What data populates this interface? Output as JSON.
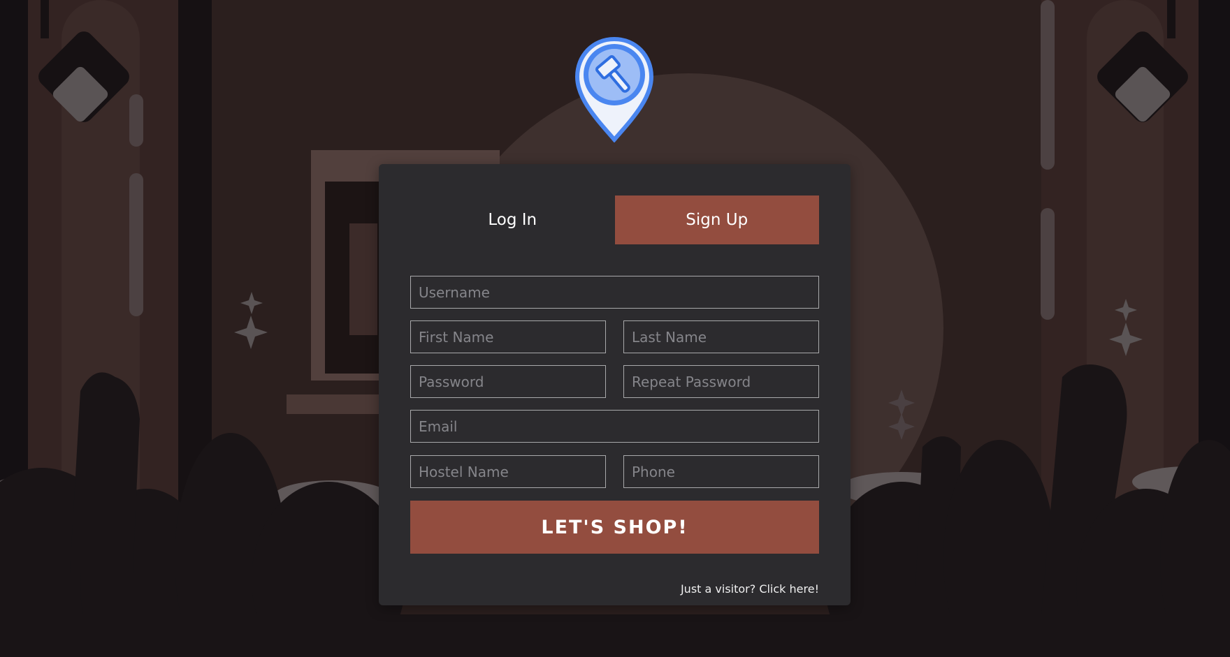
{
  "colors": {
    "accent": "#934d3f",
    "card": "#2c2b2e",
    "background": "#2a1f1e",
    "logo_blue": "#4a86f0"
  },
  "logo": {
    "icon": "auction-gavel-pin-icon"
  },
  "tabs": [
    {
      "label": "Log In",
      "active": false
    },
    {
      "label": "Sign Up",
      "active": true
    }
  ],
  "form": {
    "username": {
      "placeholder": "Username",
      "value": ""
    },
    "first_name": {
      "placeholder": "First Name",
      "value": ""
    },
    "last_name": {
      "placeholder": "Last Name",
      "value": ""
    },
    "password": {
      "placeholder": "Password",
      "value": ""
    },
    "repeat_password": {
      "placeholder": "Repeat Password",
      "value": ""
    },
    "email": {
      "placeholder": "Email",
      "value": ""
    },
    "hostel_name": {
      "placeholder": "Hostel Name",
      "value": ""
    },
    "phone": {
      "placeholder": "Phone",
      "value": ""
    },
    "submit_label": "LET'S SHOP!"
  },
  "visitor_link": "Just a visitor? Click here!"
}
